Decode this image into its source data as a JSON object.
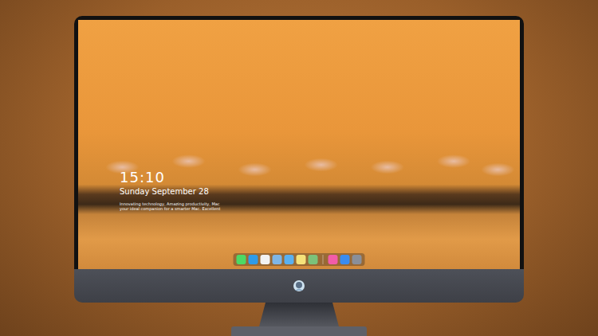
{
  "lock_screen": {
    "time": "15:10",
    "date": "Sunday September 28",
    "tagline": [
      "Innovating technology, Amazing productivity, Mac",
      "your ideal companion for a smarter Mac. Excellent"
    ]
  },
  "dock": {
    "apps": [
      {
        "color": "#4cd964"
      },
      {
        "color": "#2f9be8"
      },
      {
        "color": "#f2f2f2"
      },
      {
        "color": "#7fb6e6"
      },
      {
        "color": "#5ab0f0"
      },
      {
        "color": "#f5e27a"
      },
      {
        "color": "#7cc27a"
      }
    ],
    "extras": [
      {
        "color": "#f25ca8"
      },
      {
        "color": "#3a8cf0"
      },
      {
        "color": "#8a8f99"
      }
    ]
  }
}
